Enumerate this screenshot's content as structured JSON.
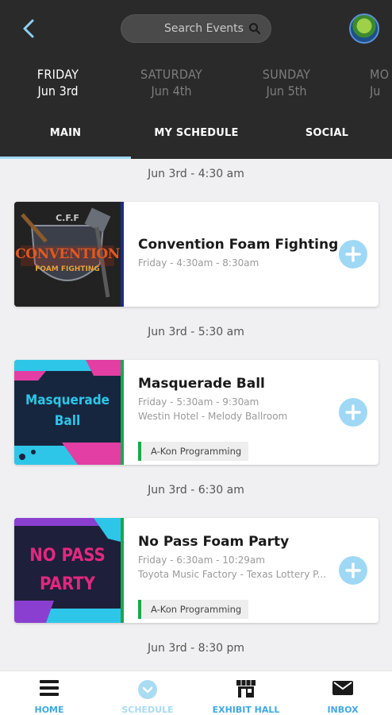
{
  "header": {
    "search_placeholder": "Search Events",
    "days": [
      {
        "name": "FRIDAY",
        "date": "Jun 3rd",
        "active": true
      },
      {
        "name": "SATURDAY",
        "date": "Jun 4th",
        "active": false
      },
      {
        "name": "SUNDAY",
        "date": "Jun 5th",
        "active": false
      },
      {
        "name": "MO",
        "date": "Ju",
        "active": false
      }
    ],
    "tabs": [
      "MAIN",
      "MY SCHEDULE",
      "SOCIAL"
    ],
    "active_tab": "MAIN"
  },
  "time_slots": [
    "Jun 3rd - 4:30 am",
    "Jun 3rd - 5:30 am",
    "Jun 3rd - 6:30 am",
    "Jun 3rd - 8:30 pm"
  ],
  "events": [
    {
      "title": "Convention Foam Fighting",
      "time": "Friday - 4:30am - 8:30am",
      "location": "",
      "tag": "",
      "thumb_text": [
        "C.F.F",
        "CONVENTION",
        "FOAM FIGHTING"
      ],
      "accent_color": "#1f2a8a"
    },
    {
      "title": "Masquerade Ball",
      "time": "Friday - 5:30am - 9:30am",
      "location": "Westin Hotel - Melody Ballroom",
      "tag": "A-Kon Programming",
      "thumb_text": [
        "Masquerade",
        "Ball"
      ],
      "accent_color": "#1aa84b"
    },
    {
      "title": "No Pass Foam Party",
      "time": "Friday - 6:30am - 10:29am",
      "location": "Toyota Music Factory - Texas Lottery P...",
      "tag": "A-Kon Programming",
      "thumb_text": [
        "NO PASS",
        "PARTY"
      ],
      "accent_color": "#1aa84b"
    }
  ],
  "bottom_nav": [
    {
      "label": "HOME",
      "icon": "menu-icon"
    },
    {
      "label": "SCHEDULE",
      "icon": "chevron-circle-icon"
    },
    {
      "label": "EXHIBIT HALL",
      "icon": "storefront-icon"
    },
    {
      "label": "INBOX",
      "icon": "mail-icon"
    }
  ],
  "colors": {
    "header_bg": "#2a2a2a",
    "accent_blue": "#9fd8f5",
    "nav_blue": "#3fa9e0",
    "tag_green": "#1aa84b"
  }
}
